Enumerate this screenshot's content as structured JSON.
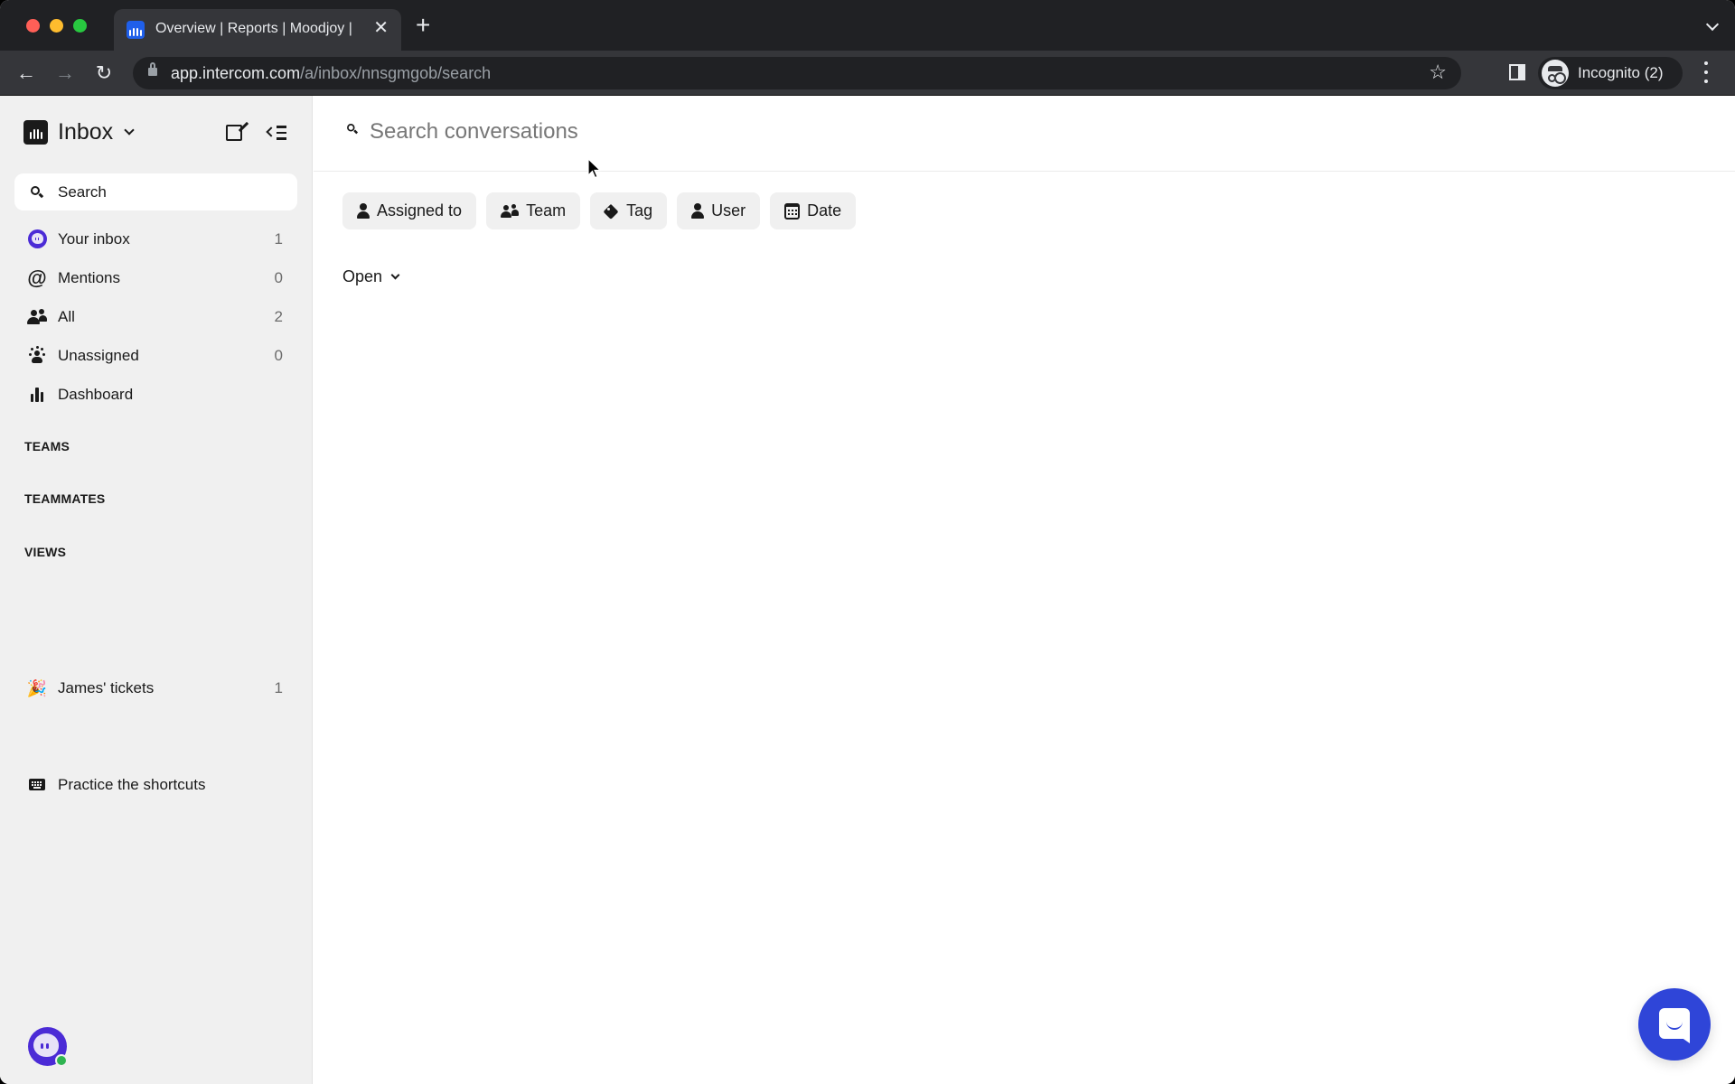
{
  "browser": {
    "tab": {
      "title": "Overview | Reports | Moodjoy |",
      "favicon": "intercom-logo-icon"
    },
    "url": {
      "host": "app.intercom.com",
      "path": "/a/inbox/nnsgmgob/search"
    },
    "profile_label": "Incognito (2)"
  },
  "sidebar": {
    "title": "Inbox",
    "search_label": "Search",
    "items": [
      {
        "label": "Your inbox",
        "count": "1",
        "icon": "ghost-avatar-icon"
      },
      {
        "label": "Mentions",
        "count": "0",
        "icon": "at-icon"
      },
      {
        "label": "All",
        "count": "2",
        "icon": "people-icon"
      },
      {
        "label": "Unassigned",
        "count": "0",
        "icon": "unassigned-icon"
      },
      {
        "label": "Dashboard",
        "count": "",
        "icon": "bar-chart-icon"
      }
    ],
    "sections": {
      "teams": "TEAMS",
      "teammates": "TEAMMATES",
      "views": "VIEWS"
    },
    "views": [
      {
        "label": "James' tickets",
        "count": "1",
        "icon": "party-popper-icon",
        "emoji": "🎉"
      }
    ],
    "shortcuts_label": "Practice the shortcuts"
  },
  "main": {
    "search_placeholder": "Search conversations",
    "filters": [
      {
        "label": "Assigned to",
        "icon": "person-icon"
      },
      {
        "label": "Team",
        "icon": "team-icon"
      },
      {
        "label": "Tag",
        "icon": "tag-icon"
      },
      {
        "label": "User",
        "icon": "user-icon"
      },
      {
        "label": "Date",
        "icon": "calendar-icon"
      }
    ],
    "status_filter": "Open"
  },
  "colors": {
    "accent": "#2f45d8",
    "avatar_purple": "#4b2bd6",
    "online_green": "#2fb451",
    "sidebar_bg": "#f0f0f0"
  }
}
